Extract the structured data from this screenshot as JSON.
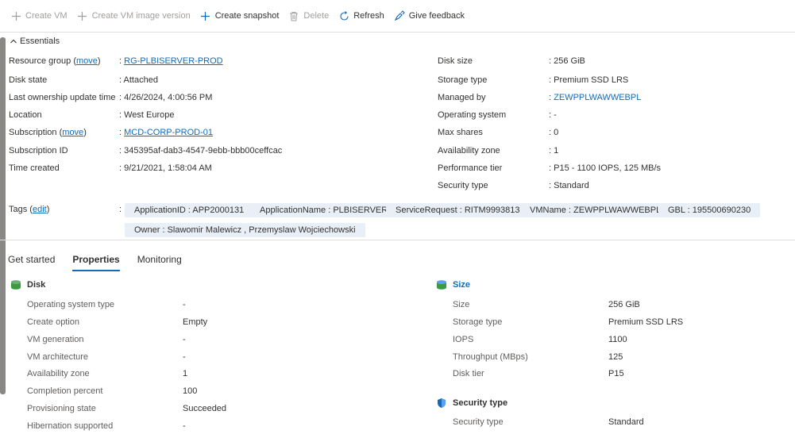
{
  "toolbar": {
    "create_vm": "Create VM",
    "create_vm_image": "Create VM image version",
    "create_snapshot": "Create snapshot",
    "delete": "Delete",
    "refresh": "Refresh",
    "give_feedback": "Give feedback"
  },
  "essentials": {
    "title": "Essentials",
    "left": [
      {
        "label": "Resource group",
        "action": "move",
        "value": "RG-PLBISERVER-PROD"
      },
      {
        "label": "Disk state",
        "value": "Attached"
      },
      {
        "label": "Last ownership update time",
        "value": "4/26/2024, 4:00:56 PM"
      },
      {
        "label": "Location",
        "value": "West Europe"
      },
      {
        "label": "Subscription",
        "action": "move",
        "value": "MCD-CORP-PROD-01"
      },
      {
        "label": "Subscription ID",
        "value": "345395af-dab3-4547-9ebb-bbb00ceffcac"
      },
      {
        "label": "Time created",
        "value": "9/21/2021, 1:58:04 AM"
      }
    ],
    "right": [
      {
        "label": "Disk size",
        "value": "256 GiB"
      },
      {
        "label": "Storage type",
        "value": "Premium SSD LRS"
      },
      {
        "label": "Managed by",
        "value": "ZEWPPLWAWWEBPL"
      },
      {
        "label": "Operating system",
        "value": "-"
      },
      {
        "label": "Max shares",
        "value": "0"
      },
      {
        "label": "Availability zone",
        "value": "1"
      },
      {
        "label": "Performance tier",
        "value": "P15 - 1100 IOPS, 125 MB/s"
      },
      {
        "label": "Security type",
        "value": "Standard"
      }
    ],
    "tags_label": "Tags",
    "tags_action": "edit",
    "tags": [
      "ApplicationID : APP2000131",
      "ApplicationName : PLBISERVER",
      "ServiceRequest : RITM9993813",
      "VMName : ZEWPPLWAWWEBPL",
      "GBL : 195500690230",
      "Owner : Slawomir Malewicz , Przemyslaw Wojciechowski"
    ]
  },
  "tabs": [
    "Get started",
    "Properties",
    "Monitoring"
  ],
  "disk_section": {
    "title": "Disk",
    "rows": [
      {
        "label": "Operating system type",
        "value": "-"
      },
      {
        "label": "Create option",
        "value": "Empty"
      },
      {
        "label": "VM generation",
        "value": "-"
      },
      {
        "label": "VM architecture",
        "value": "-"
      },
      {
        "label": "Availability zone",
        "value": "1"
      },
      {
        "label": "Completion percent",
        "value": "100"
      },
      {
        "label": "Provisioning state",
        "value": "Succeeded"
      },
      {
        "label": "Hibernation supported",
        "value": "-"
      }
    ]
  },
  "size_section": {
    "title": "Size",
    "rows": [
      {
        "label": "Size",
        "value": "256 GiB"
      },
      {
        "label": "Storage type",
        "value": "Premium SSD LRS"
      },
      {
        "label": "IOPS",
        "value": "1100"
      },
      {
        "label": "Throughput (MBps)",
        "value": "125"
      },
      {
        "label": "Disk tier",
        "value": "P15"
      }
    ]
  },
  "security_section": {
    "title": "Security type",
    "rows": [
      {
        "label": "Security type",
        "value": "Standard"
      }
    ]
  },
  "colors": {
    "accent": "#0f6cbd",
    "tag_bg": "#e8eff7"
  }
}
